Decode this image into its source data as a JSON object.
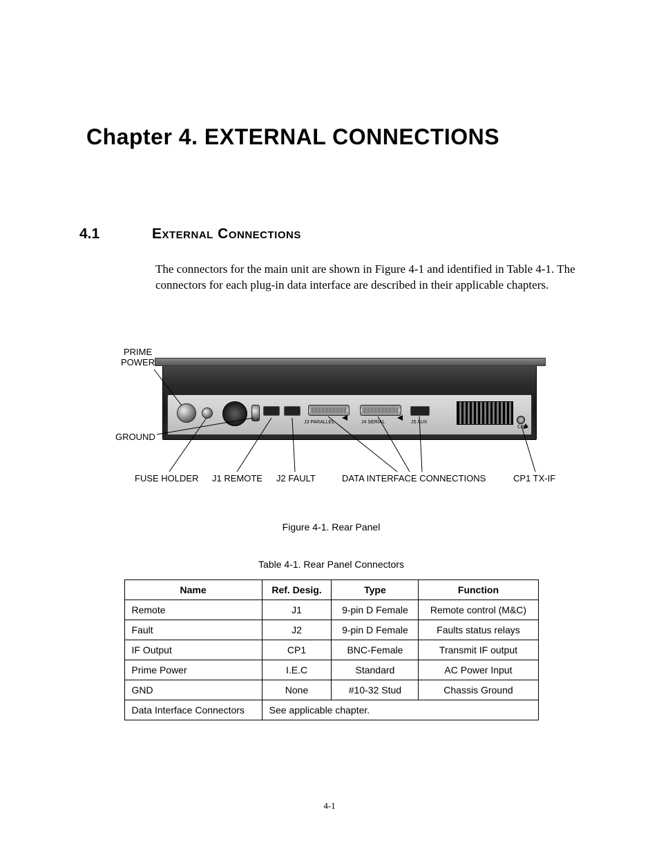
{
  "chapter_title": "Chapter  4.  EXTERNAL CONNECTIONS",
  "section": {
    "num": "4.1",
    "name": "External Connections"
  },
  "paragraph": "The connectors for the main unit are shown in Figure 4-1 and identified in Table 4-1. The connectors for each plug-in data interface are described in their applicable chapters.",
  "figure": {
    "caption": "Figure 4-1.  Rear Panel",
    "labels": {
      "prime_power": "PRIME\nPOWER",
      "ground": "GROUND",
      "fuse_holder": "FUSE HOLDER",
      "j1_remote": "J1 REMOTE",
      "j2_fault": "J2 FAULT",
      "data_interface": "DATA INTERFACE CONNECTIONS",
      "cp1_txif": "CP1 TX-IF",
      "j3_parallel": "J3 PARALLEL",
      "j4_serial": "J4 SERIAL",
      "j5_aux": "J5 AUX",
      "cp1": "CP1"
    }
  },
  "table": {
    "caption": "Table 4-1.  Rear Panel Connectors",
    "headers": [
      "Name",
      "Ref. Desig.",
      "Type",
      "Function"
    ],
    "rows": [
      {
        "name": "Remote",
        "ref": "J1",
        "type": "9-pin D Female",
        "func": "Remote control (M&C)"
      },
      {
        "name": "Fault",
        "ref": "J2",
        "type": "9-pin D Female",
        "func": "Faults status relays"
      },
      {
        "name": "IF Output",
        "ref": "CP1",
        "type": "BNC-Female",
        "func": "Transmit IF output"
      },
      {
        "name": "Prime Power",
        "ref": "I.E.C",
        "type": "Standard",
        "func": "AC Power Input"
      },
      {
        "name": "GND",
        "ref": "None",
        "type": "#10-32 Stud",
        "func": "Chassis Ground"
      }
    ],
    "last_row": {
      "name": "Data Interface Connectors",
      "note": "See applicable chapter."
    }
  },
  "page_number": "4-1"
}
